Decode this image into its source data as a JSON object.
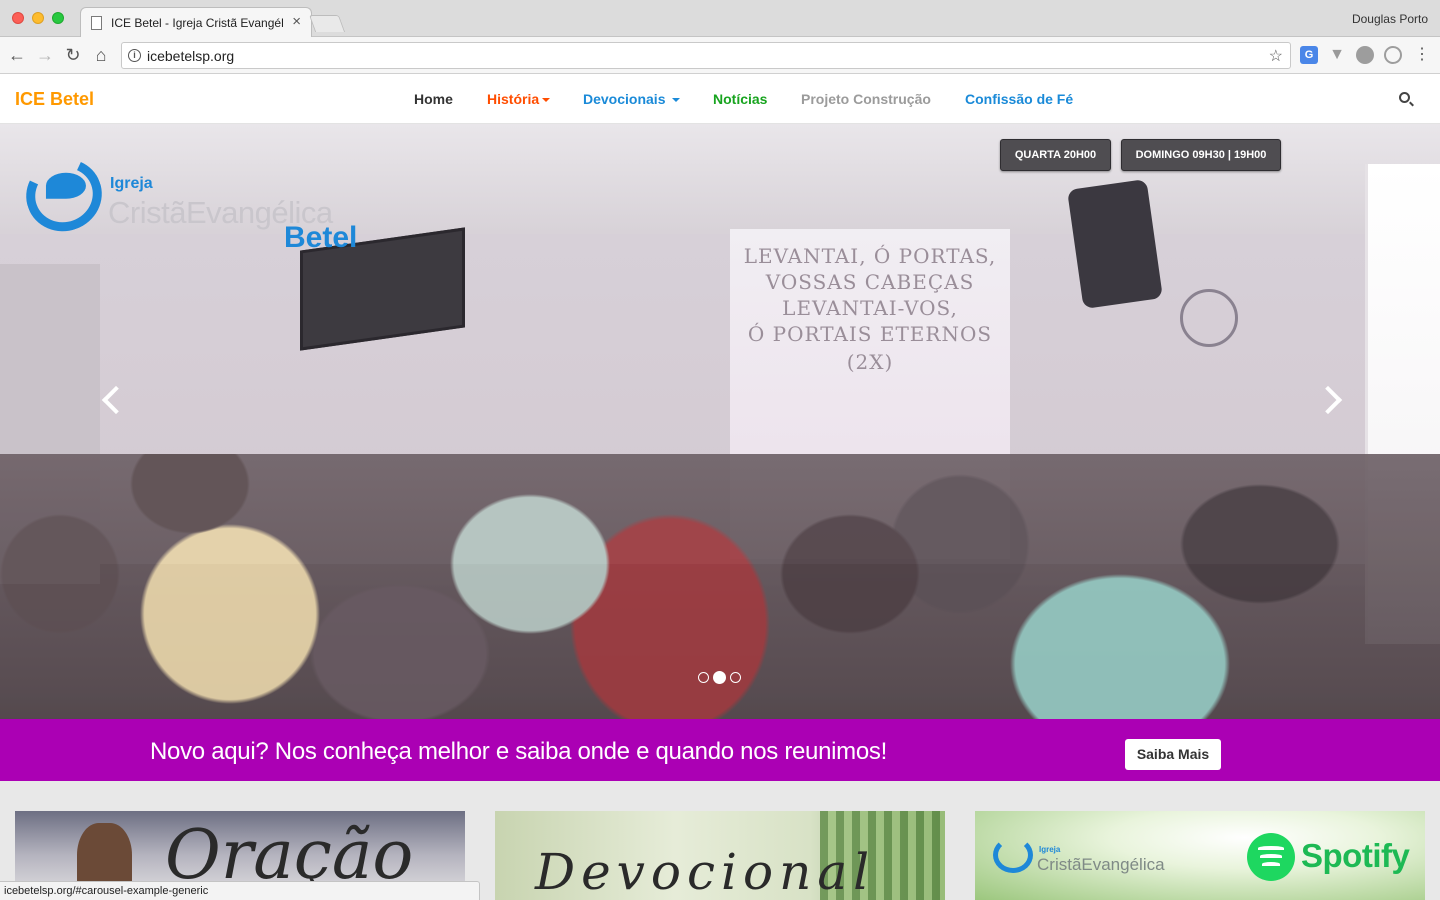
{
  "browser": {
    "tab_title": "ICE Betel - Igreja Cristã Evangélica Betel",
    "profile_name": "Douglas Porto",
    "url": "icebetelsp.org",
    "status_url": "icebetelsp.org/#carousel-example-generic",
    "translate_badge": "G"
  },
  "site": {
    "brand": "ICE Betel",
    "nav": [
      {
        "label": "Home",
        "color": "#333333"
      },
      {
        "label": "História",
        "color": "#ff4d00"
      },
      {
        "label": "Devocionais",
        "color": "#1a8ad8"
      },
      {
        "label": "Notícias",
        "color": "#18a41f"
      },
      {
        "label": "Projeto Construção",
        "color": "#9b9b9b"
      },
      {
        "label": "Confissão de Fé",
        "color": "#1a8ad8"
      }
    ],
    "brand_color": "#ff9900"
  },
  "hero": {
    "logo": {
      "igreja": "Igreja",
      "crista": "CristãEvangélica",
      "betel": "Betel"
    },
    "schedule": [
      "QUARTA 20H00",
      "DOMINGO 09H30 | 19H00"
    ],
    "screen_lines": [
      "LEVANTAI, Ó PORTAS,",
      "VOSSAS CABEÇAS",
      "LEVANTAI-VOS,",
      "Ó PORTAIS ETERNOS",
      "(2X)"
    ],
    "slide_count": 3,
    "active_slide": 2
  },
  "banner": {
    "text": "Novo aqui? Nos conheça melhor e saiba onde e quando nos reunimos!",
    "button": "Saiba Mais",
    "color": "#ab00b4"
  },
  "cards": {
    "oracao_script": "Oração",
    "devocional_script": "Devocional",
    "spotify_igreja": "Igreja",
    "spotify_crista": "CristãEvangélica",
    "spotify_word": "Spotify"
  }
}
